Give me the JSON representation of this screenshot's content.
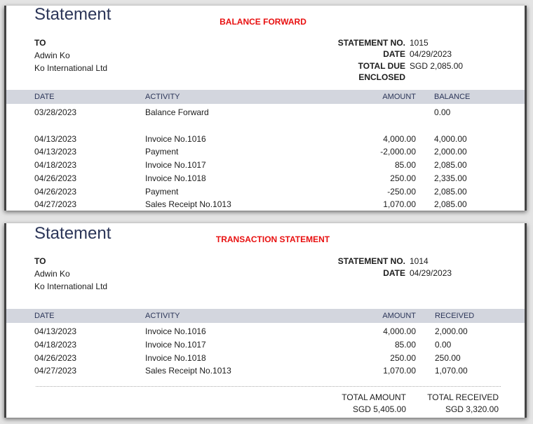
{
  "balance_forward": {
    "title": "Statement",
    "label": "BALANCE FORWARD",
    "to_label": "TO",
    "customer_name": "Adwin Ko",
    "company": "Ko International Ltd",
    "statement_no_label": "STATEMENT NO.",
    "statement_no": "1015",
    "date_label": "DATE",
    "date": "04/29/2023",
    "total_due_label": "TOTAL DUE",
    "total_due": "SGD 2,085.00",
    "enclosed_label": "ENCLOSED",
    "columns": [
      "DATE",
      "ACTIVITY",
      "AMOUNT",
      "BALANCE"
    ],
    "rows": [
      {
        "date": "03/28/2023",
        "activity": "Balance Forward",
        "amount": "",
        "balance": "0.00"
      },
      {
        "date": "04/13/2023",
        "activity": "Invoice No.1016",
        "amount": "4,000.00",
        "balance": "4,000.00"
      },
      {
        "date": "04/13/2023",
        "activity": "Payment",
        "amount": "-2,000.00",
        "balance": "2,000.00"
      },
      {
        "date": "04/18/2023",
        "activity": "Invoice No.1017",
        "amount": "85.00",
        "balance": "2,085.00"
      },
      {
        "date": "04/26/2023",
        "activity": "Invoice No.1018",
        "amount": "250.00",
        "balance": "2,335.00"
      },
      {
        "date": "04/26/2023",
        "activity": "Payment",
        "amount": "-250.00",
        "balance": "2,085.00"
      },
      {
        "date": "04/27/2023",
        "activity": "Sales Receipt No.1013",
        "amount": "1,070.00",
        "balance": "2,085.00"
      }
    ]
  },
  "transaction": {
    "title": "Statement",
    "label": "TRANSACTION STATEMENT",
    "to_label": "TO",
    "customer_name": "Adwin Ko",
    "company": "Ko International Ltd",
    "statement_no_label": "STATEMENT NO.",
    "statement_no": "1014",
    "date_label": "DATE",
    "date": "04/29/2023",
    "columns": [
      "DATE",
      "ACTIVITY",
      "AMOUNT",
      "RECEIVED"
    ],
    "rows": [
      {
        "date": "04/13/2023",
        "activity": "Invoice No.1016",
        "amount": "4,000.00",
        "received": "2,000.00"
      },
      {
        "date": "04/18/2023",
        "activity": "Invoice No.1017",
        "amount": "85.00",
        "received": "0.00"
      },
      {
        "date": "04/26/2023",
        "activity": "Invoice No.1018",
        "amount": "250.00",
        "received": "250.00"
      },
      {
        "date": "04/27/2023",
        "activity": "Sales Receipt No.1013",
        "amount": "1,070.00",
        "received": "1,070.00"
      }
    ],
    "total_amount_label": "TOTAL AMOUNT",
    "total_amount": "SGD 5,405.00",
    "total_received_label": "TOTAL RECEIVED",
    "total_received": "SGD 3,320.00"
  }
}
